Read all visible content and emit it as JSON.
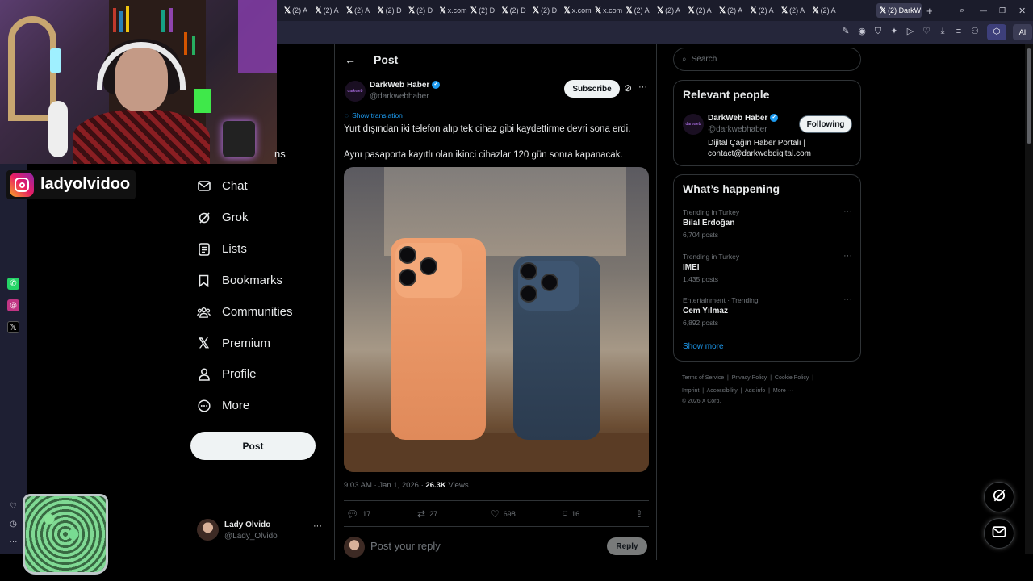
{
  "browser": {
    "tabs": [
      {
        "label": "(2) A"
      },
      {
        "label": "(2) A"
      },
      {
        "label": "(2) A"
      },
      {
        "label": "(2) D"
      },
      {
        "label": "(2) D"
      },
      {
        "label": "x.com"
      },
      {
        "label": "(2) D"
      },
      {
        "label": "(2) D"
      },
      {
        "label": "(2) D"
      },
      {
        "label": "x.com"
      },
      {
        "label": "x.com"
      },
      {
        "label": "(2) A"
      },
      {
        "label": "(2) A"
      },
      {
        "label": "(2) A"
      },
      {
        "label": "(2) A"
      },
      {
        "label": "(2) A"
      },
      {
        "label": "(2) A"
      },
      {
        "label": "(2) A"
      }
    ],
    "active_tab": "(2) DarkW",
    "ai_label": "AI"
  },
  "overlay": {
    "instagram_handle": "ladyolvidoo",
    "partial_text": "ns"
  },
  "nav": {
    "items": [
      {
        "label": "Chat",
        "icon": "mail-icon"
      },
      {
        "label": "Grok",
        "icon": "grok-icon"
      },
      {
        "label": "Lists",
        "icon": "list-icon"
      },
      {
        "label": "Bookmarks",
        "icon": "bookmark-icon"
      },
      {
        "label": "Communities",
        "icon": "communities-icon"
      },
      {
        "label": "Premium",
        "icon": "x-logo-icon"
      },
      {
        "label": "Profile",
        "icon": "person-icon"
      },
      {
        "label": "More",
        "icon": "more-icon"
      }
    ],
    "post_button": "Post",
    "account": {
      "name": "Lady Olvido",
      "handle": "@Lady_Olvido"
    }
  },
  "post": {
    "header_title": "Post",
    "author_name": "DarkWeb Haber",
    "author_handle": "@darkwebhaber",
    "subscribe_label": "Subscribe",
    "show_translation": "Show translation",
    "text_line1": "Yurt dışından iki telefon alıp tek cihaz gibi kaydettirme devri sona erdi.",
    "text_line2": "Aynı pasaporta kayıtlı olan ikinci cihazlar 120 gün sonra kapanacak.",
    "timestamp": "9:03 AM · Jan 1, 2026 · ",
    "views_count": "26.3K",
    "views_label": " Views",
    "stats": {
      "replies": "17",
      "reposts": "27",
      "likes": "698",
      "bookmarks": "16"
    },
    "reply_placeholder": "Post your reply",
    "reply_button": "Reply"
  },
  "sidebar_right": {
    "search_placeholder": "Search",
    "relevant_people": {
      "title": "Relevant people",
      "name": "DarkWeb Haber",
      "handle": "@darkwebhaber",
      "bio_line1": "Dijital Çağın Haber Portalı |",
      "bio_line2": "contact@darkwebdigital.com",
      "follow_label": "Following"
    },
    "happening": {
      "title": "What’s happening",
      "trends": [
        {
          "category": "Trending in Turkey",
          "name": "Bilal Erdoğan",
          "count": "6,704 posts"
        },
        {
          "category": "Trending in Turkey",
          "name": "IMEI",
          "count": "1,435 posts"
        },
        {
          "category": "Entertainment · Trending",
          "name": "Cem Yılmaz",
          "count": "6,892 posts"
        }
      ],
      "show_more": "Show more"
    },
    "footer": {
      "terms": "Terms of Service",
      "privacy": "Privacy Policy",
      "cookie": "Cookie Policy",
      "imprint": "Imprint",
      "accessibility": "Accessibility",
      "ads": "Ads info",
      "more": "More ···",
      "copyright": "© 2026 X Corp."
    }
  },
  "colors": {
    "accent": "#1d9bf0",
    "background": "#000000",
    "border": "#2f3336"
  }
}
